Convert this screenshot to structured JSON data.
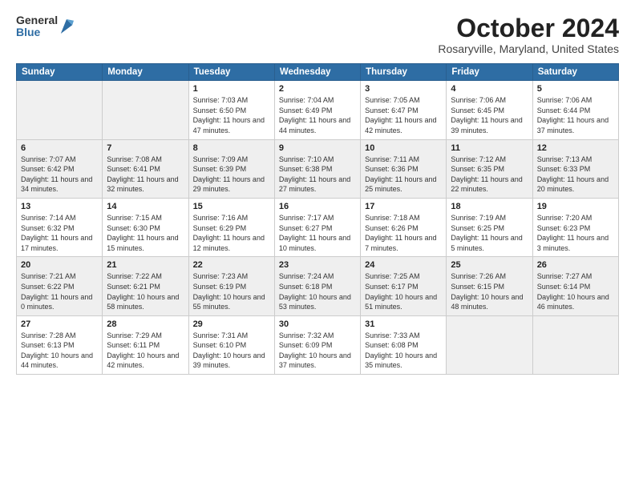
{
  "header": {
    "logo_general": "General",
    "logo_blue": "Blue",
    "month_title": "October 2024",
    "location": "Rosaryville, Maryland, United States"
  },
  "days_of_week": [
    "Sunday",
    "Monday",
    "Tuesday",
    "Wednesday",
    "Thursday",
    "Friday",
    "Saturday"
  ],
  "weeks": [
    [
      {
        "day": "",
        "sunrise": "",
        "sunset": "",
        "daylight": ""
      },
      {
        "day": "",
        "sunrise": "",
        "sunset": "",
        "daylight": ""
      },
      {
        "day": "1",
        "sunrise": "Sunrise: 7:03 AM",
        "sunset": "Sunset: 6:50 PM",
        "daylight": "Daylight: 11 hours and 47 minutes."
      },
      {
        "day": "2",
        "sunrise": "Sunrise: 7:04 AM",
        "sunset": "Sunset: 6:49 PM",
        "daylight": "Daylight: 11 hours and 44 minutes."
      },
      {
        "day": "3",
        "sunrise": "Sunrise: 7:05 AM",
        "sunset": "Sunset: 6:47 PM",
        "daylight": "Daylight: 11 hours and 42 minutes."
      },
      {
        "day": "4",
        "sunrise": "Sunrise: 7:06 AM",
        "sunset": "Sunset: 6:45 PM",
        "daylight": "Daylight: 11 hours and 39 minutes."
      },
      {
        "day": "5",
        "sunrise": "Sunrise: 7:06 AM",
        "sunset": "Sunset: 6:44 PM",
        "daylight": "Daylight: 11 hours and 37 minutes."
      }
    ],
    [
      {
        "day": "6",
        "sunrise": "Sunrise: 7:07 AM",
        "sunset": "Sunset: 6:42 PM",
        "daylight": "Daylight: 11 hours and 34 minutes."
      },
      {
        "day": "7",
        "sunrise": "Sunrise: 7:08 AM",
        "sunset": "Sunset: 6:41 PM",
        "daylight": "Daylight: 11 hours and 32 minutes."
      },
      {
        "day": "8",
        "sunrise": "Sunrise: 7:09 AM",
        "sunset": "Sunset: 6:39 PM",
        "daylight": "Daylight: 11 hours and 29 minutes."
      },
      {
        "day": "9",
        "sunrise": "Sunrise: 7:10 AM",
        "sunset": "Sunset: 6:38 PM",
        "daylight": "Daylight: 11 hours and 27 minutes."
      },
      {
        "day": "10",
        "sunrise": "Sunrise: 7:11 AM",
        "sunset": "Sunset: 6:36 PM",
        "daylight": "Daylight: 11 hours and 25 minutes."
      },
      {
        "day": "11",
        "sunrise": "Sunrise: 7:12 AM",
        "sunset": "Sunset: 6:35 PM",
        "daylight": "Daylight: 11 hours and 22 minutes."
      },
      {
        "day": "12",
        "sunrise": "Sunrise: 7:13 AM",
        "sunset": "Sunset: 6:33 PM",
        "daylight": "Daylight: 11 hours and 20 minutes."
      }
    ],
    [
      {
        "day": "13",
        "sunrise": "Sunrise: 7:14 AM",
        "sunset": "Sunset: 6:32 PM",
        "daylight": "Daylight: 11 hours and 17 minutes."
      },
      {
        "day": "14",
        "sunrise": "Sunrise: 7:15 AM",
        "sunset": "Sunset: 6:30 PM",
        "daylight": "Daylight: 11 hours and 15 minutes."
      },
      {
        "day": "15",
        "sunrise": "Sunrise: 7:16 AM",
        "sunset": "Sunset: 6:29 PM",
        "daylight": "Daylight: 11 hours and 12 minutes."
      },
      {
        "day": "16",
        "sunrise": "Sunrise: 7:17 AM",
        "sunset": "Sunset: 6:27 PM",
        "daylight": "Daylight: 11 hours and 10 minutes."
      },
      {
        "day": "17",
        "sunrise": "Sunrise: 7:18 AM",
        "sunset": "Sunset: 6:26 PM",
        "daylight": "Daylight: 11 hours and 7 minutes."
      },
      {
        "day": "18",
        "sunrise": "Sunrise: 7:19 AM",
        "sunset": "Sunset: 6:25 PM",
        "daylight": "Daylight: 11 hours and 5 minutes."
      },
      {
        "day": "19",
        "sunrise": "Sunrise: 7:20 AM",
        "sunset": "Sunset: 6:23 PM",
        "daylight": "Daylight: 11 hours and 3 minutes."
      }
    ],
    [
      {
        "day": "20",
        "sunrise": "Sunrise: 7:21 AM",
        "sunset": "Sunset: 6:22 PM",
        "daylight": "Daylight: 11 hours and 0 minutes."
      },
      {
        "day": "21",
        "sunrise": "Sunrise: 7:22 AM",
        "sunset": "Sunset: 6:21 PM",
        "daylight": "Daylight: 10 hours and 58 minutes."
      },
      {
        "day": "22",
        "sunrise": "Sunrise: 7:23 AM",
        "sunset": "Sunset: 6:19 PM",
        "daylight": "Daylight: 10 hours and 55 minutes."
      },
      {
        "day": "23",
        "sunrise": "Sunrise: 7:24 AM",
        "sunset": "Sunset: 6:18 PM",
        "daylight": "Daylight: 10 hours and 53 minutes."
      },
      {
        "day": "24",
        "sunrise": "Sunrise: 7:25 AM",
        "sunset": "Sunset: 6:17 PM",
        "daylight": "Daylight: 10 hours and 51 minutes."
      },
      {
        "day": "25",
        "sunrise": "Sunrise: 7:26 AM",
        "sunset": "Sunset: 6:15 PM",
        "daylight": "Daylight: 10 hours and 48 minutes."
      },
      {
        "day": "26",
        "sunrise": "Sunrise: 7:27 AM",
        "sunset": "Sunset: 6:14 PM",
        "daylight": "Daylight: 10 hours and 46 minutes."
      }
    ],
    [
      {
        "day": "27",
        "sunrise": "Sunrise: 7:28 AM",
        "sunset": "Sunset: 6:13 PM",
        "daylight": "Daylight: 10 hours and 44 minutes."
      },
      {
        "day": "28",
        "sunrise": "Sunrise: 7:29 AM",
        "sunset": "Sunset: 6:11 PM",
        "daylight": "Daylight: 10 hours and 42 minutes."
      },
      {
        "day": "29",
        "sunrise": "Sunrise: 7:31 AM",
        "sunset": "Sunset: 6:10 PM",
        "daylight": "Daylight: 10 hours and 39 minutes."
      },
      {
        "day": "30",
        "sunrise": "Sunrise: 7:32 AM",
        "sunset": "Sunset: 6:09 PM",
        "daylight": "Daylight: 10 hours and 37 minutes."
      },
      {
        "day": "31",
        "sunrise": "Sunrise: 7:33 AM",
        "sunset": "Sunset: 6:08 PM",
        "daylight": "Daylight: 10 hours and 35 minutes."
      },
      {
        "day": "",
        "sunrise": "",
        "sunset": "",
        "daylight": ""
      },
      {
        "day": "",
        "sunrise": "",
        "sunset": "",
        "daylight": ""
      }
    ]
  ]
}
